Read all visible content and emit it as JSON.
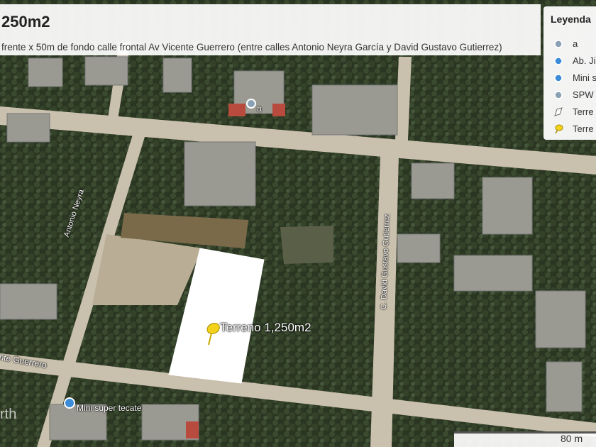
{
  "header": {
    "title": "250m2",
    "subtitle": "frente x 50m de fondo calle frontal Av Vicente Guerrero (entre calles Antonio Neyra García y David Gustavo Gutierrez)"
  },
  "legend": {
    "title": "Leyenda",
    "items": [
      {
        "label": "a",
        "icon": "pin-icon",
        "color": "#8aa0b4"
      },
      {
        "label": "Ab. Ji",
        "icon": "pin-icon",
        "color": "#3a8bd8"
      },
      {
        "label": "Mini s",
        "icon": "pin-icon",
        "color": "#3a8bd8"
      },
      {
        "label": "SPW",
        "icon": "pin-icon",
        "color": "#8aa0b4"
      },
      {
        "label": "Terre",
        "icon": "polygon-icon",
        "color": "#ffffff"
      },
      {
        "label": "Terre",
        "icon": "pushpin-icon",
        "color": "#f2d21b"
      }
    ]
  },
  "map": {
    "parcel_label": "Terreno 1,250m2",
    "streets": {
      "antonio": "Antonio Neyra",
      "david": "C. David Gustavo Gutierrez",
      "guerrero": "nte Guerrero"
    },
    "places": {
      "a": "a",
      "minisuper": "Mini super tecate"
    },
    "watermark": "rth",
    "scale_label": "80 m"
  }
}
